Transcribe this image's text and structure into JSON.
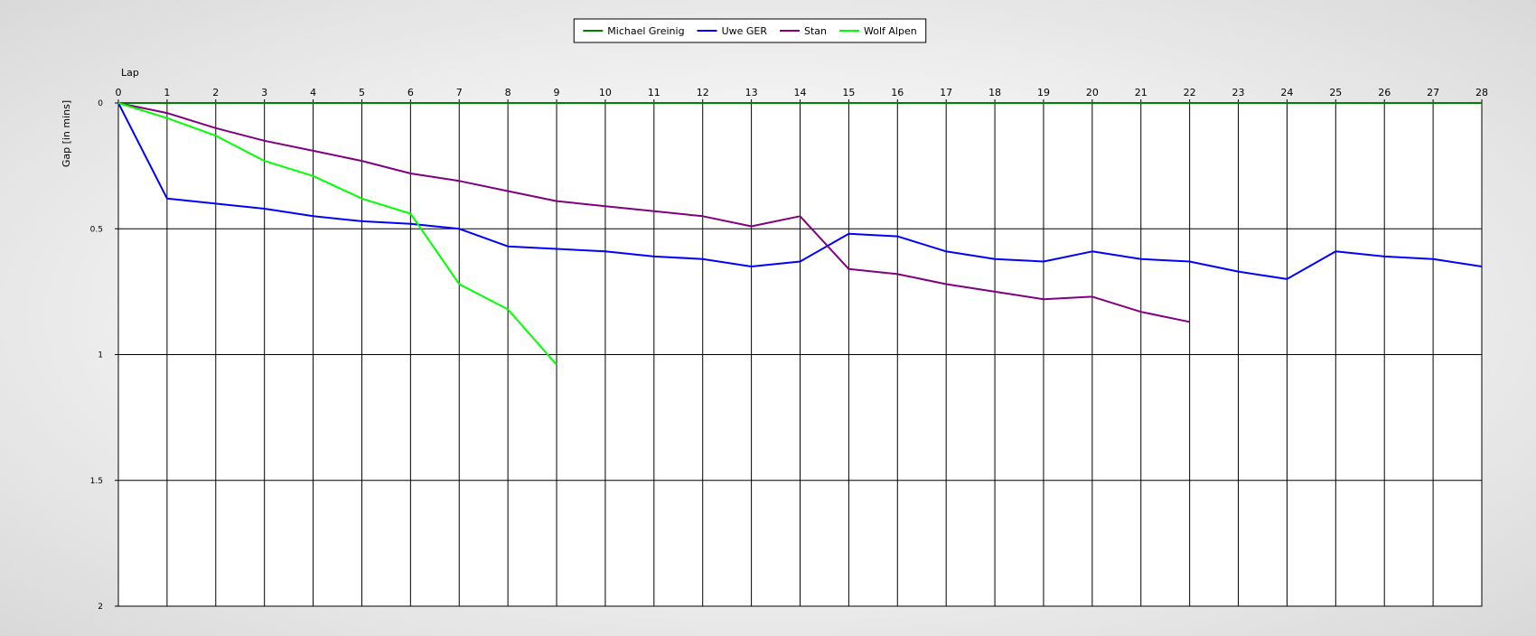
{
  "chart_data": {
    "type": "line",
    "xlabel": "Lap",
    "ylabel": "Gap [in mins]",
    "xlim": [
      0,
      28
    ],
    "ylim": [
      0,
      2
    ],
    "y_inverted": true,
    "x_ticks": [
      0,
      1,
      2,
      3,
      4,
      5,
      6,
      7,
      8,
      9,
      10,
      11,
      12,
      13,
      14,
      15,
      16,
      17,
      18,
      19,
      20,
      21,
      22,
      23,
      24,
      25,
      26,
      27,
      28
    ],
    "y_ticks": [
      0,
      0.5,
      1,
      1.5,
      2
    ],
    "y_tick_labels": [
      "0",
      "0.5",
      "1",
      "1.5",
      "2"
    ],
    "grid": true,
    "legend_position": "top-center",
    "series": [
      {
        "name": "Michael Greinig",
        "color": "#008000",
        "x": [
          0,
          1,
          2,
          3,
          4,
          5,
          6,
          7,
          8,
          9,
          10,
          11,
          12,
          13,
          14,
          15,
          16,
          17,
          18,
          19,
          20,
          21,
          22,
          23,
          24,
          25,
          26,
          27,
          28
        ],
        "values": [
          0,
          0,
          0,
          0,
          0,
          0,
          0,
          0,
          0,
          0,
          0,
          0,
          0,
          0,
          0,
          0,
          0,
          0,
          0,
          0,
          0,
          0,
          0,
          0,
          0,
          0,
          0,
          0,
          0
        ]
      },
      {
        "name": "Uwe GER",
        "color": "#0000ff",
        "x": [
          0,
          1,
          2,
          3,
          4,
          5,
          6,
          7,
          8,
          9,
          10,
          11,
          12,
          13,
          14,
          15,
          16,
          17,
          18,
          19,
          20,
          21,
          22,
          23,
          24,
          25,
          26,
          27,
          28
        ],
        "values": [
          0,
          0.38,
          0.4,
          0.42,
          0.45,
          0.47,
          0.48,
          0.5,
          0.57,
          0.58,
          0.59,
          0.61,
          0.62,
          0.65,
          0.63,
          0.52,
          0.53,
          0.59,
          0.62,
          0.63,
          0.59,
          0.62,
          0.63,
          0.67,
          0.7,
          0.59,
          0.61,
          0.62,
          0.65
        ]
      },
      {
        "name": "Stan",
        "color": "#800080",
        "x": [
          0,
          1,
          2,
          3,
          4,
          5,
          6,
          7,
          8,
          9,
          10,
          11,
          12,
          13,
          14,
          15,
          16,
          17,
          18,
          19,
          20,
          21,
          22
        ],
        "values": [
          0,
          0.04,
          0.1,
          0.15,
          0.19,
          0.23,
          0.28,
          0.31,
          0.35,
          0.39,
          0.41,
          0.43,
          0.45,
          0.49,
          0.45,
          0.66,
          0.68,
          0.72,
          0.75,
          0.78,
          0.77,
          0.83,
          0.87
        ]
      },
      {
        "name": "Wolf Alpen",
        "color": "#00ff00",
        "x": [
          0,
          1,
          2,
          3,
          4,
          5,
          6,
          7,
          8,
          9
        ],
        "values": [
          0,
          0.06,
          0.13,
          0.23,
          0.29,
          0.38,
          0.44,
          0.72,
          0.82,
          1.04
        ]
      }
    ]
  }
}
